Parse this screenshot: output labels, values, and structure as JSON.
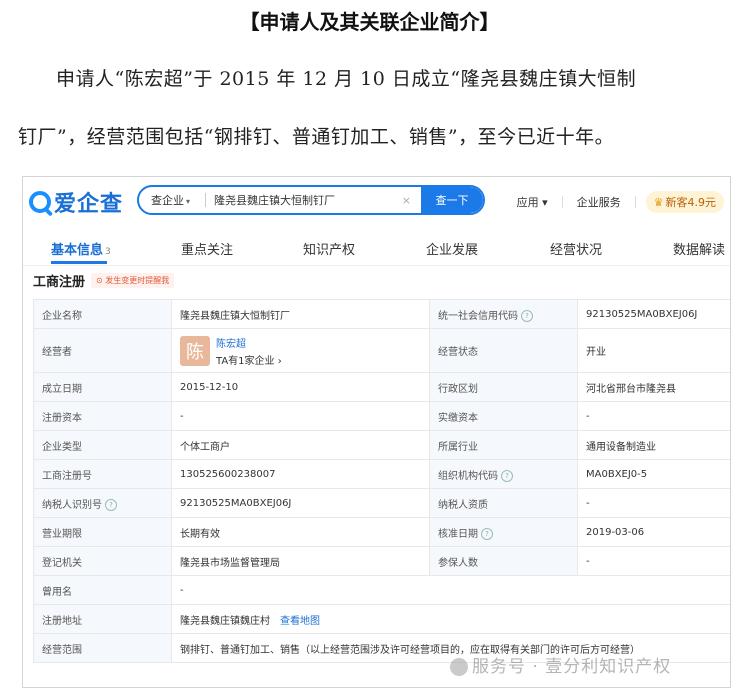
{
  "document": {
    "title": "【申请人及其关联企业简介】",
    "paragraph_line1": "申请人“陈宏超”于 2015 年 12 月 10 日成立“隆尧县魏庄镇大恒制",
    "paragraph_line2": "钉厂”，经营范围包括“钢排钉、普通钉加工、销售”，至今已近十年。"
  },
  "app": {
    "logo_text": "爱企查",
    "search": {
      "type_label": "查企业",
      "value": "隆尧县魏庄镇大恒制钉厂",
      "clear": "×",
      "button": "查一下"
    },
    "nav": {
      "apps": "应用",
      "services": "企业服务",
      "promo": "新客4.9元"
    },
    "tabs": [
      {
        "label": "基本信息",
        "count": "3"
      },
      {
        "label": "重点关注"
      },
      {
        "label": "知识产权"
      },
      {
        "label": "企业发展"
      },
      {
        "label": "经营状况"
      },
      {
        "label": "数据解读"
      }
    ],
    "section": {
      "title": "工商注册",
      "badge": "发生变更时提醒我"
    },
    "registration": {
      "company_name_label": "企业名称",
      "company_name": "隆尧县魏庄镇大恒制钉厂",
      "credit_code_label": "统一社会信用代码",
      "credit_code": "92130525MA0BXEJ06J",
      "operator_label": "经营者",
      "operator_avatar": "陈",
      "operator_name": "陈宏超",
      "operator_sub": "TA有1家企业 ›",
      "status_label": "经营状态",
      "status": "开业",
      "founded_label": "成立日期",
      "founded": "2015-12-10",
      "region_label": "行政区划",
      "region": "河北省邢台市隆尧县",
      "capital_label": "注册资本",
      "capital": "-",
      "paid_capital_label": "实缴资本",
      "paid_capital": "-",
      "type_label": "企业类型",
      "type": "个体工商户",
      "industry_label": "所属行业",
      "industry": "通用设备制造业",
      "reg_no_label": "工商注册号",
      "reg_no": "130525600238007",
      "org_code_label": "组织机构代码",
      "org_code": "MA0BXEJ0-5",
      "taxpayer_id_label": "纳税人识别号",
      "taxpayer_id": "92130525MA0BXEJ06J",
      "taxpayer_quality_label": "纳税人资质",
      "taxpayer_quality": "-",
      "term_label": "营业期限",
      "term": "长期有效",
      "approved_label": "核准日期",
      "approved": "2019-03-06",
      "authority_label": "登记机关",
      "authority": "隆尧县市场监督管理局",
      "insured_label": "参保人数",
      "insured": "-",
      "former_name_label": "曾用名",
      "former_name": "-",
      "address_label": "注册地址",
      "address": "隆尧县魏庄镇魏庄村",
      "map_link": "查看地图",
      "scope_label": "经营范围",
      "scope": "钢排钉、普通钉加工、销售（以上经营范围涉及许可经营项目的，应在取得有关部门的许可后方可经营）"
    }
  },
  "watermark": "服务号 · 壹分利知识产权"
}
